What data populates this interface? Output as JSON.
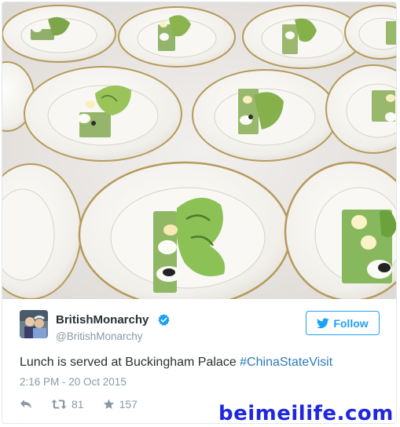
{
  "tweet": {
    "author_name": "BritishMonarchy",
    "author_handle": "@BritishMonarchy",
    "verified": true,
    "follow_label": "Follow",
    "text_prefix": "Lunch is served at Buckingham Palace ",
    "hashtag": "#ChinaStateVisit",
    "timestamp": "2:16 PM - 20 Oct 2015",
    "retweet_count": "81",
    "like_count": "157"
  },
  "watermark": "beimeilife.com",
  "icons": {
    "verified": "verified-badge-icon",
    "follow": "twitter-bird-icon",
    "reply": "reply-icon",
    "retweet": "retweet-icon",
    "like": "star-icon"
  },
  "colors": {
    "accent": "#1da1f2",
    "hashtag": "#2b7bb9",
    "muted": "#8899a6",
    "text": "#292f33",
    "watermark": "#1f27e0"
  }
}
